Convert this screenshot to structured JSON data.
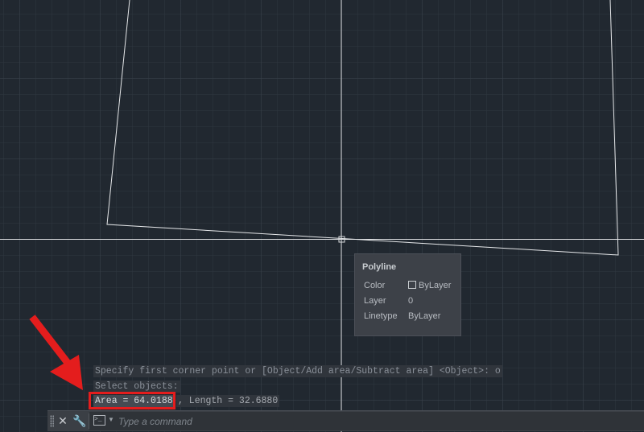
{
  "properties_tooltip": {
    "title": "Polyline",
    "rows": [
      {
        "label": "Color",
        "value": "ByLayer"
      },
      {
        "label": "Layer",
        "value": "0"
      },
      {
        "label": "Linetype",
        "value": "ByLayer"
      }
    ]
  },
  "command_history": [
    "Specify first corner point or [Object/Add area/Subtract area] <Object>: o",
    "Select objects:"
  ],
  "result": {
    "area": "Area = 64.0188",
    "length": ", Length = 32.6880"
  },
  "command_line": {
    "placeholder": "Type a command"
  },
  "colors": {
    "background": "#212830",
    "annotation": "#e41d1d"
  }
}
